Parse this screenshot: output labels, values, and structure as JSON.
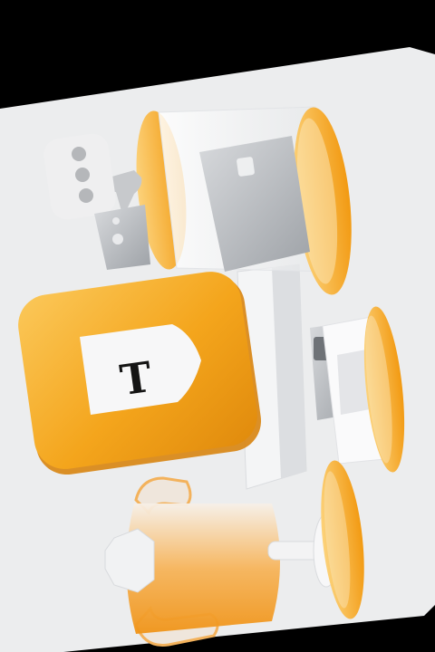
{
  "scene": {
    "background_color": "#000000",
    "card_color": "#ECEDEE",
    "accent_color": "#F4A51C",
    "accent_light": "#FBC85A",
    "metal_color": "#B9BCC0",
    "white_part_color": "#F7F7F8"
  },
  "objects": {
    "chat_bubble_icon": "chat-bubble-icon",
    "credit_card_icon": "credit-card-icon",
    "shield_badge_icon": "shield-badge-icon",
    "shield_letter": "T",
    "trophy_icon": "trophy-icon"
  }
}
